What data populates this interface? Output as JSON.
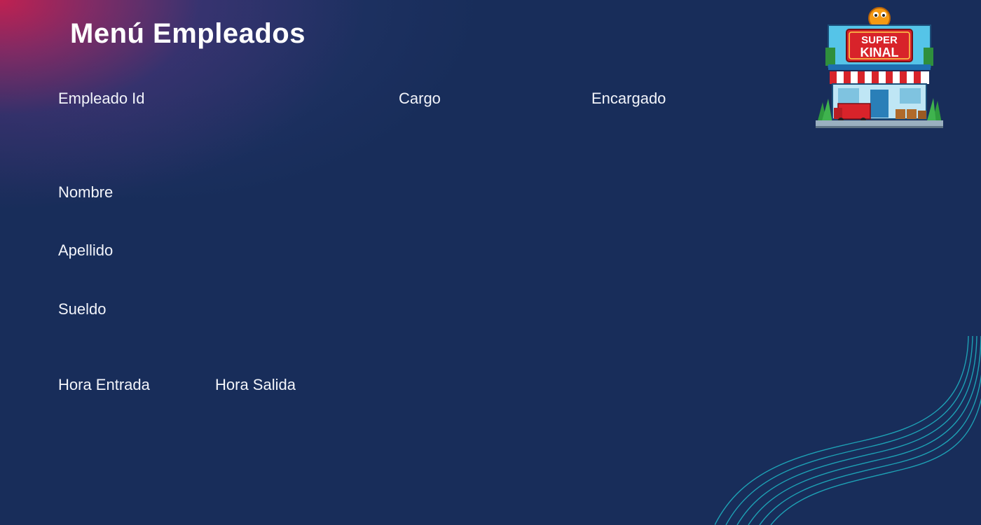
{
  "page": {
    "title": "Menú Empleados"
  },
  "form": {
    "empleado_id_label": "Empleado Id",
    "cargo_label": "Cargo",
    "encargado_label": "Encargado",
    "nombre_label": "Nombre",
    "apellido_label": "Apellido",
    "sueldo_label": "Sueldo",
    "hora_entrada_label": "Hora Entrada",
    "hora_salida_label": "Hora Salida"
  },
  "logo": {
    "line1": "SUPER",
    "line2": "KINAL"
  },
  "colors": {
    "background": "#182d5a",
    "accent_pink": "#c82050",
    "wave_teal": "#1fb5c4",
    "logo_red": "#d8232a"
  }
}
